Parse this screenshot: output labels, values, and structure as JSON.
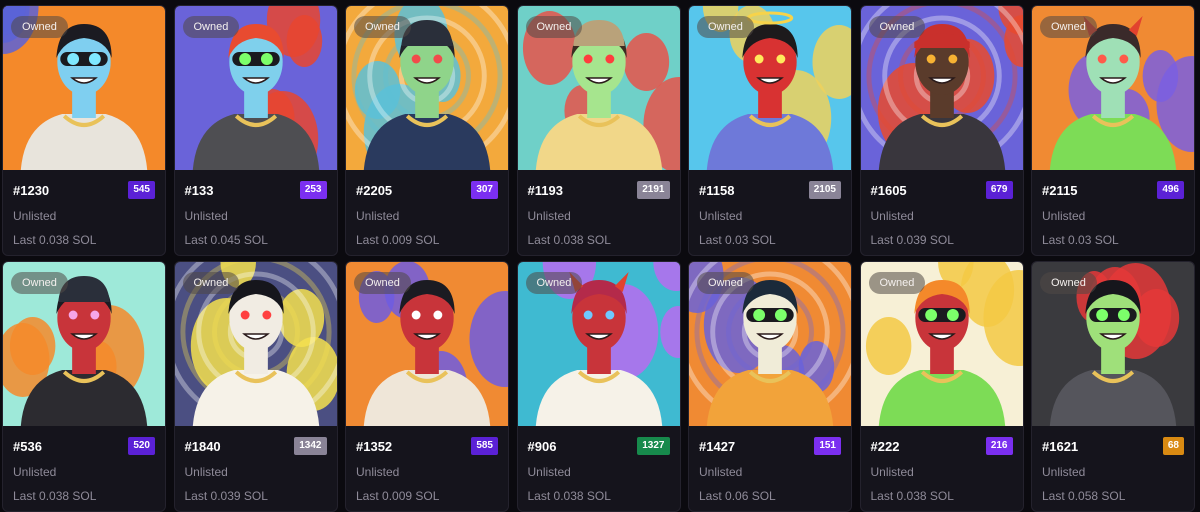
{
  "cards": [
    {
      "name": "#1230",
      "rank": "545",
      "badge": "Owned",
      "status": "Unlisted",
      "last": "Last 0.038 SOL",
      "rank_color": "#5b21d6",
      "bg": "#f4892a",
      "blob": "#5a63d8",
      "skin": "#7fcff0",
      "shirt": "#e8e4dc",
      "hair": "#1b1b22",
      "eyes": "#7fe8ff",
      "accessory": "visor"
    },
    {
      "name": "#133",
      "rank": "253",
      "badge": "Owned",
      "status": "Unlisted",
      "last": "Last 0.045 SOL",
      "rank_color": "#7b2ff0",
      "bg": "#6a63d9",
      "blob": "#e8452f",
      "skin": "#7fd0ec",
      "shirt": "#4e4e52",
      "hair": "#e84b30",
      "eyes": "#7cff6a",
      "accessory": "goggles"
    },
    {
      "name": "#2205",
      "rank": "307",
      "badge": "Owned",
      "status": "Unlisted",
      "last": "Last 0.009 SOL",
      "rank_color": "#7b2ff0",
      "bg": "#f3a93c",
      "blob": "#5bc1d8",
      "skin": "#8fd48a",
      "shirt": "#2a3a5e",
      "hair": "#22232b",
      "eyes": "#f14b4b",
      "accessory": "beanie"
    },
    {
      "name": "#1193",
      "rank": "2191",
      "badge": "Owned",
      "status": "Unlisted",
      "last": "Last 0.038 SOL",
      "rank_color": "#8a8497",
      "bg": "#6fd0c8",
      "blob": "#e8544a",
      "skin": "#a6e58e",
      "shirt": "#f1d789",
      "hair": "#3a2c22",
      "eyes": "#ff3d3d",
      "accessory": "cap"
    },
    {
      "name": "#1158",
      "rank": "2105",
      "badge": "Owned",
      "status": "Unlisted",
      "last": "Last 0.03 SOL",
      "rank_color": "#8a8497",
      "bg": "#57c6ec",
      "blob": "#efd15c",
      "skin": "#d83232",
      "shirt": "#6e79d9",
      "hair": "#1d1a1c",
      "eyes": "#ffea5c",
      "accessory": "halo"
    },
    {
      "name": "#1605",
      "rank": "679",
      "badge": "Owned",
      "status": "Unlisted",
      "last": "Last 0.039 SOL",
      "rank_color": "#5b21d6",
      "bg": "#6a63d9",
      "blob": "#e84a2e",
      "skin": "#5a3b2b",
      "shirt": "#39363d",
      "hair": "#c9302c",
      "eyes": "#f7b233",
      "accessory": "bandana"
    },
    {
      "name": "#2115",
      "rank": "496",
      "badge": "Owned",
      "status": "Unlisted",
      "last": "Last 0.03 SOL",
      "rank_color": "#5b21d6",
      "bg": "#f08a33",
      "blob": "#7a5fe0",
      "skin": "#9fe0b6",
      "shirt": "#7ddc56",
      "hair": "#3a2a2a",
      "eyes": "#ff5a4a",
      "accessory": "horns"
    },
    {
      "name": "#536",
      "rank": "520",
      "badge": "Owned",
      "status": "Unlisted",
      "last": "Last 0.038 SOL",
      "rank_color": "#5b21d6",
      "bg": "#9ee9d9",
      "blob": "#f4892a",
      "skin": "#c8343a",
      "shirt": "#2c2b30",
      "hair": "#1b1b22",
      "eyes": "#f6a6e8",
      "accessory": "beanie"
    },
    {
      "name": "#1840",
      "rank": "1342",
      "badge": "Owned",
      "status": "Unlisted",
      "last": "Last 0.039 SOL",
      "rank_color": "#8a8497",
      "bg": "#4b4f82",
      "blob": "#f5e04f",
      "skin": "#f1ece3",
      "shirt": "#f6f2e8",
      "hair": "#16161c",
      "eyes": "#ff4040",
      "accessory": "none"
    },
    {
      "name": "#1352",
      "rank": "585",
      "badge": "Owned",
      "status": "Unlisted",
      "last": "Last 0.009 SOL",
      "rank_color": "#5b21d6",
      "bg": "#f08a33",
      "blob": "#6f5ce0",
      "skin": "#c8343a",
      "shirt": "#efe6d8",
      "hair": "#1b1b22",
      "eyes": "#ffffff",
      "accessory": "none"
    },
    {
      "name": "#906",
      "rank": "1327",
      "badge": "Owned",
      "status": "Unlisted",
      "last": "Last 0.038 SOL",
      "rank_color": "#178a4c",
      "bg": "#3fbad1",
      "blob": "#b86bf0",
      "skin": "#c8343a",
      "shirt": "#f6f2e8",
      "hair": "#b42a4a",
      "eyes": "#6fc9ff",
      "accessory": "horns"
    },
    {
      "name": "#1427",
      "rank": "151",
      "badge": "Owned",
      "status": "Unlisted",
      "last": "Last 0.06 SOL",
      "rank_color": "#7b2ff0",
      "bg": "#f08a33",
      "blob": "#6a63d9",
      "skin": "#f0ecd8",
      "shirt": "#f2a33a",
      "hair": "#1b2a3a",
      "eyes": "#7cff6a",
      "accessory": "goggles"
    },
    {
      "name": "#222",
      "rank": "216",
      "badge": "Owned",
      "status": "Unlisted",
      "last": "Last 0.038 SOL",
      "rank_color": "#7b2ff0",
      "bg": "#f7f0d6",
      "blob": "#f3c944",
      "skin": "#c8343a",
      "shirt": "#7ddc56",
      "hair": "#f4892a",
      "eyes": "#7cff6a",
      "accessory": "visor"
    },
    {
      "name": "#1621",
      "rank": "68",
      "badge": "Owned",
      "status": "Unlisted",
      "last": "Last 0.058 SOL",
      "rank_color": "#d98a12",
      "bg": "#3a3a3e",
      "blob": "#e53838",
      "skin": "#9fe07a",
      "shirt": "#55555c",
      "hair": "#16161c",
      "eyes": "#7cff6a",
      "accessory": "goggles"
    }
  ]
}
